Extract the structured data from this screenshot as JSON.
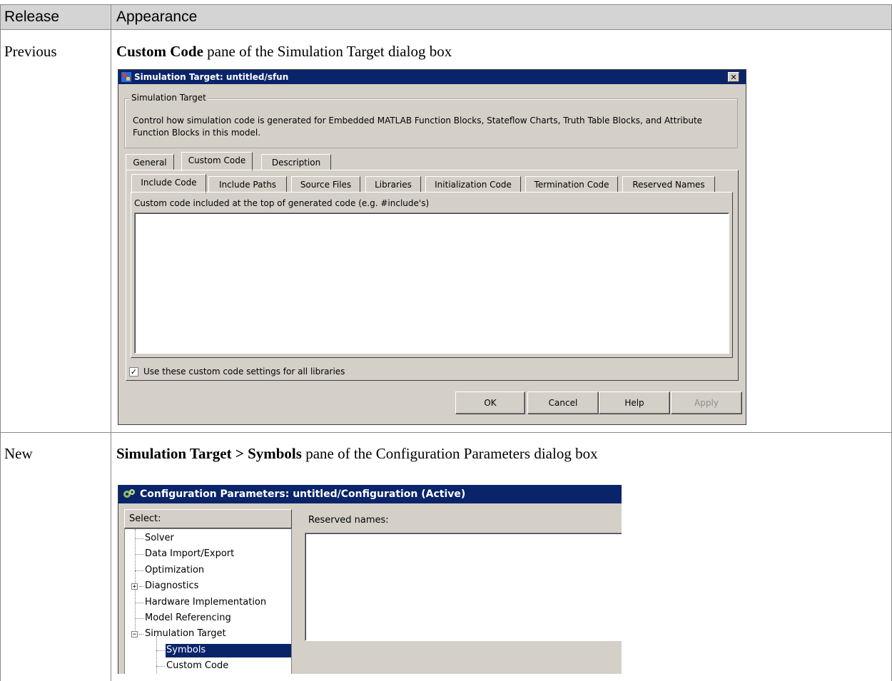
{
  "table": {
    "headers": [
      "Release",
      "Appearance"
    ],
    "rows": [
      {
        "release": "Previous",
        "caption_bold": "Custom Code",
        "caption_rest": " pane of the Simulation Target dialog box"
      },
      {
        "release": "New",
        "caption_bold": "Simulation Target > Symbols",
        "caption_rest": " pane of the Configuration Parameters dialog box"
      }
    ]
  },
  "dialog1": {
    "title": "Simulation Target: untitled/sfun",
    "close_symbol": "✕",
    "group_label": "Simulation Target",
    "description": "Control how simulation code is generated for Embedded MATLAB Function Blocks, Stateflow Charts, Truth Table Blocks, and Attribute Function Blocks in this model.",
    "tabs": [
      "General",
      "Custom Code",
      "Description"
    ],
    "selected_tab": "Custom Code",
    "subtabs": [
      "Include Code",
      "Include Paths",
      "Source Files",
      "Libraries",
      "Initialization Code",
      "Termination Code",
      "Reserved Names"
    ],
    "selected_subtab": "Include Code",
    "field_label": "Custom code included at the top of generated code (e.g. #include's)",
    "field_value": "",
    "checkbox_label": "Use these custom code settings for all libraries",
    "checkbox_checked": true,
    "check_symbol": "✓",
    "buttons": {
      "ok": "OK",
      "cancel": "Cancel",
      "help": "Help",
      "apply": "Apply"
    }
  },
  "dialog2": {
    "title": "Configuration Parameters: untitled/Configuration (Active)",
    "select_label": "Select:",
    "reserved_label": "Reserved names:",
    "reserved_value": "",
    "tree": [
      {
        "label": "Solver",
        "expander": ""
      },
      {
        "label": "Data Import/Export",
        "expander": ""
      },
      {
        "label": "Optimization",
        "expander": ""
      },
      {
        "label": "Diagnostics",
        "expander": "+"
      },
      {
        "label": "Hardware Implementation",
        "expander": ""
      },
      {
        "label": "Model Referencing",
        "expander": ""
      },
      {
        "label": "Simulation Target",
        "expander": "−"
      },
      {
        "label": "Symbols",
        "expander": "",
        "selected": true
      },
      {
        "label": "Custom Code",
        "expander": ""
      }
    ],
    "selection_color": "#0a246a"
  },
  "colors": {
    "header_bg": "#d4d4d4",
    "dialog_bg": "#d4d0c8",
    "title_bg": "#0a246a"
  }
}
